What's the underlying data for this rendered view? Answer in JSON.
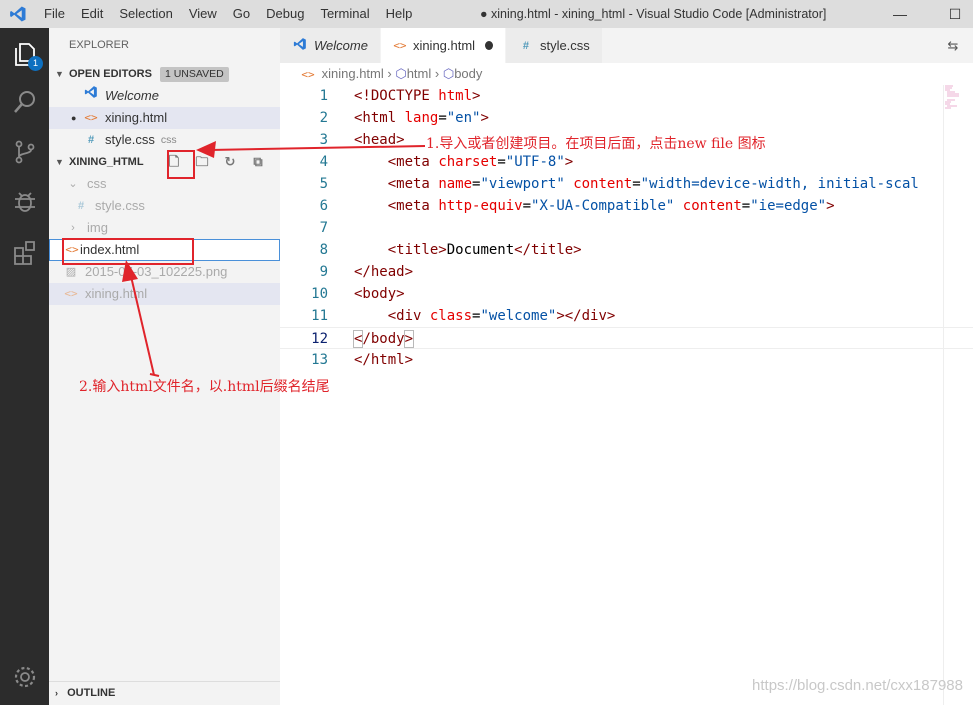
{
  "titlebar": {
    "menu": [
      "File",
      "Edit",
      "Selection",
      "View",
      "Go",
      "Debug",
      "Terminal",
      "Help"
    ],
    "window_title": "● xining.html - xining_html - Visual Studio Code [Administrator]"
  },
  "activity_bar": {
    "explorer_badge": "1"
  },
  "sidebar": {
    "title": "EXPLORER",
    "open_editors": {
      "label": "OPEN EDITORS",
      "badge": "1 UNSAVED",
      "items": [
        {
          "name": "Welcome"
        },
        {
          "name": "xining.html"
        },
        {
          "name": "style.css",
          "folder": "css"
        }
      ]
    },
    "project": {
      "label": "XINING_HTML",
      "items": [
        "css",
        "style.css",
        "img",
        "index.html",
        "2015-07-03_102225.png",
        "xining.html"
      ]
    },
    "outline_label": "OUTLINE"
  },
  "editor": {
    "tabs": [
      "Welcome",
      "xining.html",
      "style.css"
    ],
    "breadcrumb": [
      "xining.html",
      "html",
      "body"
    ],
    "line_numbers": [
      "1",
      "2",
      "3",
      "4",
      "5",
      "6",
      "7",
      "8",
      "9",
      "10",
      "11",
      "12",
      "13"
    ]
  },
  "annotations": {
    "note1": "1.导入或者创建项目。在项目后面，点击new file 图标",
    "note2": "2.输入html文件名，以.html后缀名结尾"
  },
  "watermark": "https://blog.csdn.net/cxx187988",
  "colors": {
    "activity_bar": "#2c2c2c",
    "accent": "#0e70c0",
    "annotation_red": "#e0242b"
  }
}
